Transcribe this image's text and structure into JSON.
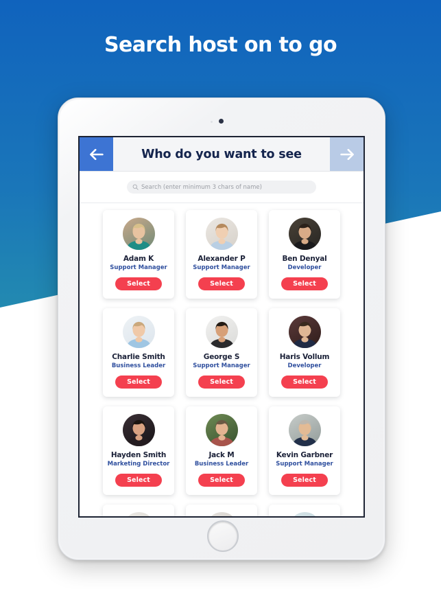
{
  "page": {
    "headline": "Search host on to go",
    "background": {
      "gradient_top": "#1063bd",
      "gradient_bottom": "#35aca2",
      "wedge_color": "#ffffff"
    }
  },
  "device": {
    "type": "tablet",
    "camera_icon": "camera-dot",
    "home_button_icon": "home-circle"
  },
  "app": {
    "header": {
      "back_icon": "arrow-left-icon",
      "title": "Who do you want to see",
      "forward_icon": "arrow-right-icon",
      "back_color": "#3d74d3",
      "forward_color": "#b9cbe6",
      "title_color": "#14244d"
    },
    "search": {
      "icon": "search-icon",
      "placeholder": "Search (enter minimum 3 chars of name)",
      "value": ""
    },
    "select_label": "Select",
    "accent_color": "#f4404f",
    "role_color": "#2f4f9e",
    "people": [
      {
        "name": "Adam K",
        "role": "Support Manager",
        "select_label": "Select",
        "avatar": "avatar-adam-k"
      },
      {
        "name": "Alexander P",
        "role": "Support Manager",
        "select_label": "Select",
        "avatar": "avatar-alexander-p"
      },
      {
        "name": "Ben Denyal",
        "role": "Developer",
        "select_label": "Select",
        "avatar": "avatar-ben-denyal"
      },
      {
        "name": "Charlie Smith",
        "role": "Business Leader",
        "select_label": "Select",
        "avatar": "avatar-charlie-smith"
      },
      {
        "name": "George S",
        "role": "Support Manager",
        "select_label": "Select",
        "avatar": "avatar-george-s"
      },
      {
        "name": "Haris Vollum",
        "role": "Developer",
        "select_label": "Select",
        "avatar": "avatar-haris-vollum"
      },
      {
        "name": "Hayden Smith",
        "role": "Marketing Director",
        "select_label": "Select",
        "avatar": "avatar-hayden-smith"
      },
      {
        "name": "Jack M",
        "role": "Business Leader",
        "select_label": "Select",
        "avatar": "avatar-jack-m"
      },
      {
        "name": "Kevin Garbner",
        "role": "Support Manager",
        "select_label": "Select",
        "avatar": "avatar-kevin-garbner"
      }
    ],
    "partial_row_avatars": [
      "avatar-row4-1",
      "avatar-row4-2",
      "avatar-row4-3"
    ]
  }
}
